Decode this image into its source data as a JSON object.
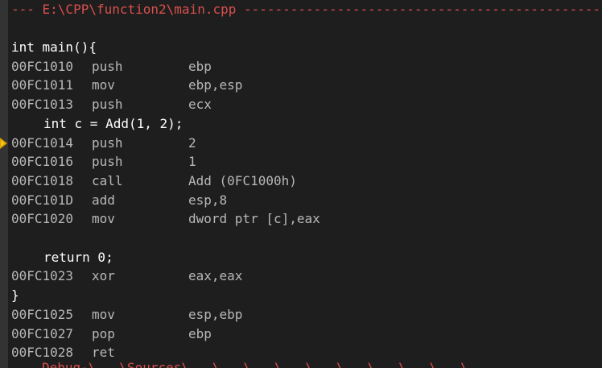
{
  "header": "--- E:\\CPP\\function2\\main.cpp ------------------------------------------------",
  "lines": [
    {
      "kind": "src",
      "text": "int main(){"
    },
    {
      "kind": "asm",
      "addr": "00FC1010",
      "op": "push",
      "arg": "ebp"
    },
    {
      "kind": "asm",
      "addr": "00FC1011",
      "op": "mov",
      "arg": "ebp,esp"
    },
    {
      "kind": "asm",
      "addr": "00FC1013",
      "op": "push",
      "arg": "ecx"
    },
    {
      "kind": "src-indent",
      "text": "int c = Add(1, 2);"
    },
    {
      "kind": "asm",
      "addr": "00FC1014",
      "op": "push",
      "arg": "2",
      "current": true
    },
    {
      "kind": "asm",
      "addr": "00FC1016",
      "op": "push",
      "arg": "1"
    },
    {
      "kind": "asm",
      "addr": "00FC1018",
      "op": "call",
      "arg": "Add (0FC1000h)"
    },
    {
      "kind": "asm",
      "addr": "00FC101D",
      "op": "add",
      "arg": "esp,8"
    },
    {
      "kind": "asm",
      "addr": "00FC1020",
      "op": "mov",
      "arg": "dword ptr [c],eax"
    },
    {
      "kind": "blank"
    },
    {
      "kind": "src-indent",
      "text": "return 0;"
    },
    {
      "kind": "asm",
      "addr": "00FC1023",
      "op": "xor",
      "arg": "eax,eax"
    },
    {
      "kind": "src",
      "text": "}"
    },
    {
      "kind": "asm",
      "addr": "00FC1025",
      "op": "mov",
      "arg": "esp,ebp"
    },
    {
      "kind": "asm",
      "addr": "00FC1027",
      "op": "pop",
      "arg": "ebp"
    },
    {
      "kind": "asm",
      "addr": "00FC1028",
      "op": "ret",
      "arg": ""
    }
  ],
  "cutoff_text": "Debug-\\...\\Sources\\...\\...\\...\\...\\...\\...\\...\\...\\...\\...",
  "colors": {
    "background": "#1e1e1e",
    "header": "#d8504d",
    "instruction_pointer": "#f5c518"
  },
  "icons": {
    "instruction_pointer": "current-instruction-arrow-icon"
  }
}
